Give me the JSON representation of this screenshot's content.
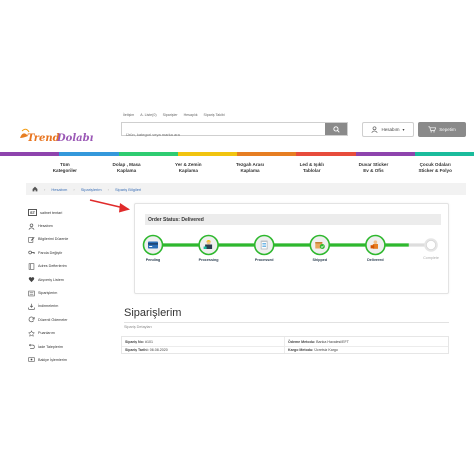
{
  "header": {
    "top_links": [
      "İletişim",
      "A. Liste(0)",
      "Siparişler",
      "Hesaplık",
      "Sipariş Takibi"
    ],
    "logo_text": "TrendDolabı",
    "search_placeholder": "Ürün, kategori veya marka ara",
    "account_label": "Hesabım",
    "cart_label": "Sepetim"
  },
  "band_colors": [
    "#8e44ad",
    "#3498db",
    "#2ecc71",
    "#f1c40f",
    "#e67e22",
    "#e74c3c",
    "#8e44ad",
    "#1abc9c"
  ],
  "categories": [
    "Tüm\nKategoriler",
    "Dolap , Masa\nKaplama",
    "Yer & Zemin\nKaplama",
    "Tezgah Arası\nKaplama",
    "Led & Işıklı\nTablolar",
    "Duvar Sticker\nEv & Ofis",
    "Çocuk Odaları\nSticker & Folyo"
  ],
  "breadcrumb": {
    "home": "Hesabım",
    "item1": "Siparişlerim",
    "item2": "Sipariş Bilgileri"
  },
  "sidebar": [
    {
      "icon": "user-icon",
      "label": "Hesabım"
    },
    {
      "icon": "edit-icon",
      "label": "Bilgilerimi Düzenle"
    },
    {
      "icon": "key-icon",
      "label": "Parola Değiştir"
    },
    {
      "icon": "book-icon",
      "label": "Adres Defterlerim"
    },
    {
      "icon": "heart-icon",
      "label": "Alışveriş Listem"
    },
    {
      "icon": "list-icon",
      "label": "Siparişlerim"
    },
    {
      "icon": "download-icon",
      "label": "İndirmelerim"
    },
    {
      "icon": "refresh-icon",
      "label": "Düzenli Ödemeler"
    },
    {
      "icon": "star-icon",
      "label": "Puanlarım"
    },
    {
      "icon": "return-icon",
      "label": "İade Taleplerim"
    },
    {
      "icon": "money-icon",
      "label": "Bakiye İşlemlerim"
    }
  ],
  "sidebar_header": "saitnet tentari",
  "status": {
    "title": "Order Status: Delivered",
    "progress_fraction": 0.92,
    "colors": {
      "active": "#2eb82e",
      "inactive": "#dddddd",
      "icon_fill": "#efefef"
    },
    "steps": [
      {
        "label": "Pending",
        "icon": "credit-card-icon",
        "done": true
      },
      {
        "label": "Processing",
        "icon": "worker-icon",
        "done": true
      },
      {
        "label": "Processed",
        "icon": "clipboard-icon",
        "done": true
      },
      {
        "label": "Shipped",
        "icon": "box-check-icon",
        "done": true
      },
      {
        "label": "Delivered",
        "icon": "delivery-icon",
        "done": true
      },
      {
        "label": "Complete",
        "icon": "circle-icon",
        "done": false
      }
    ]
  },
  "orders": {
    "title": "Siparişlerim",
    "subtitle": "Sipariş Detayları",
    "order_no_label": "Sipariş No:",
    "order_no_value": "#101",
    "order_date_label": "Sipariş Tarihi:",
    "order_date_value": "06.08.2020",
    "payment_label": "Ödeme Metodu:",
    "payment_value": "Banka Havalesi/EFT",
    "shipping_label": "Kargo Metodu:",
    "shipping_value": "Ücretsiz Kargo"
  }
}
